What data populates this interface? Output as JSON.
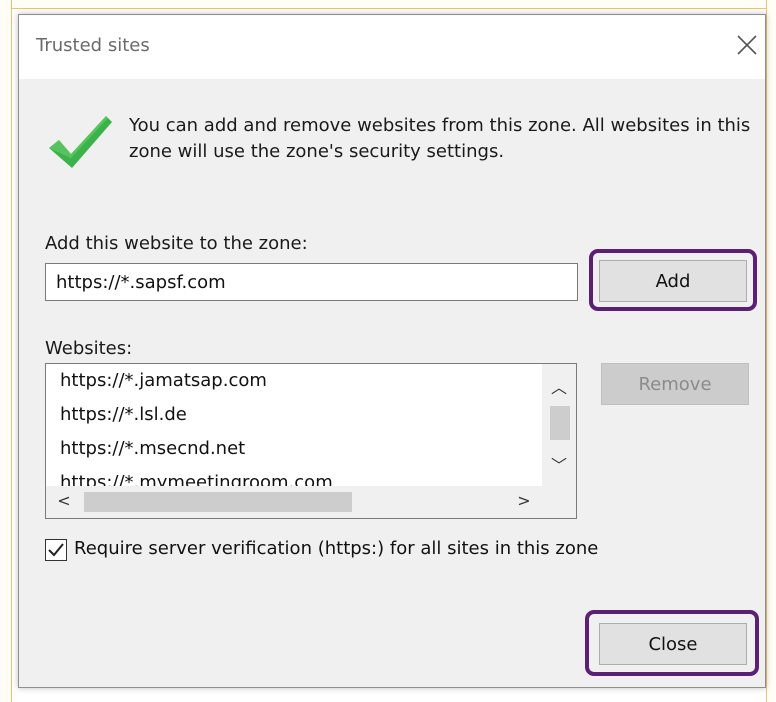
{
  "dialog": {
    "title": "Trusted sites",
    "intro_text": "You can add and remove websites from this zone. All websites in this zone will use the zone's security settings.",
    "add_label": "Add this website to the zone:",
    "add_input_value": "https://*.sapsf.com",
    "add_button": "Add",
    "websites_label": "Websites:",
    "websites": [
      "https://*.jamatsap.com",
      "https://*.lsl.de",
      "https://*.msecnd.net",
      "https://*.mymeetingroom.com"
    ],
    "remove_button": "Remove",
    "require_https_label": "Require server verification (https:) for all sites in this zone",
    "require_https_checked": true,
    "close_button": "Close"
  },
  "icons": {
    "checkmark": "green-checkmark-icon",
    "close": "close-icon",
    "scroll_up": "chevron-up-icon",
    "scroll_down": "chevron-down-icon",
    "scroll_left": "chevron-left-icon",
    "scroll_right": "chevron-right-icon"
  },
  "colors": {
    "highlight": "#5b1f74",
    "checkmark": "#3cb34a",
    "dialog_bg": "#f0f0f0",
    "button_bg": "#e1e1e1",
    "backdrop_edge": "#f3c36a"
  }
}
